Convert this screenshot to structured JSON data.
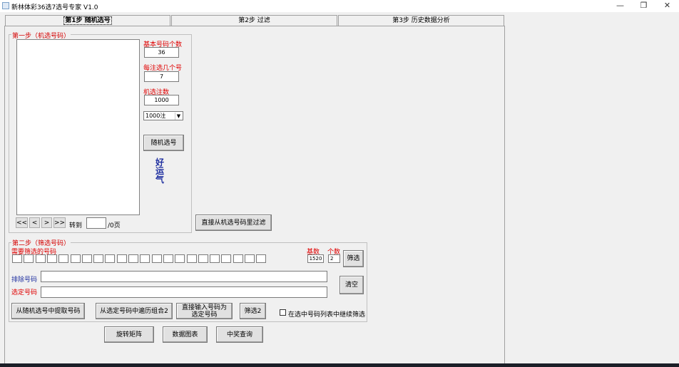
{
  "window": {
    "title": "新林体彩36选7选号专家 V1.0",
    "minimize": "—",
    "restore": "❐",
    "close": "✕"
  },
  "tabs": [
    "第1步 随机选号",
    "第2步 过滤",
    "第3步 历史数据分析"
  ],
  "step1": {
    "group_title": "第一步（机选号码）",
    "base_count_label": "基本号码个数",
    "base_count_value": "36",
    "per_bet_label": "每注选几个号",
    "per_bet_value": "7",
    "machine_bets_label": "机选注数",
    "machine_bets_value": "1000",
    "bets_select_value": "1000注",
    "random_button": "随机选号",
    "luck_text": "好运气",
    "nav_first": "<<",
    "nav_prev": "<",
    "nav_next": ">",
    "nav_last": ">>",
    "goto_label": "转到",
    "page_value": "",
    "page_total": "/0页",
    "filter_direct_button": "直接从机选号码里过滤"
  },
  "step2": {
    "group_title": "第二步（筛选号码）",
    "need_filter_label": "需要筛选的号码",
    "base_label": "基数",
    "count_label": "个数",
    "base_value": "1520",
    "count_value": "2",
    "filter_button": "筛选",
    "exclude_label": "排除号码",
    "exclude_value": "",
    "fixed_label": "选定号码",
    "fixed_value": "",
    "clear_button": "清空",
    "extract_button": "从随机选号中提取号码",
    "traverse_button": "从选定号码中遍历组合2",
    "direct_input_button": "直接输入号码为选定号码",
    "filter2_button": "筛选2",
    "continue_checkbox_label": "在选中号码列表中继续筛选",
    "continue_checked": false
  },
  "bottom_buttons": [
    "旋转矩阵",
    "数据图表",
    "中奖查询"
  ]
}
